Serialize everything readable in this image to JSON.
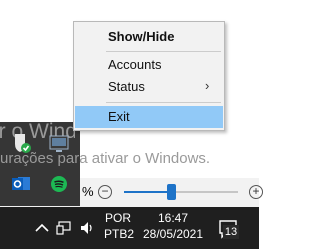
{
  "desktop": {
    "watermark_title": "Ativar o Windows",
    "watermark_hint": "urações para ativar o Windows."
  },
  "tray_flyout": {
    "icons": [
      "shield-check-icon",
      "screen-capture-icon",
      "outlook-icon",
      "spotify-icon"
    ]
  },
  "volume": {
    "percent_suffix": "%",
    "minus_label": "−",
    "plus_label": "+",
    "level": 0.42
  },
  "context_menu": {
    "items": [
      {
        "label": "Show/Hide",
        "bold": true
      },
      {
        "label": "Accounts"
      },
      {
        "label": "Status",
        "submenu_arrow": "›"
      },
      {
        "label": "Exit",
        "highlighted": true
      }
    ]
  },
  "taskbar": {
    "language_line1": "POR",
    "language_line2": "PTB2",
    "time": "16:47",
    "date": "28/05/2021",
    "notification_count": "13"
  },
  "colors": {
    "menu_highlight": "#91c9f7",
    "accent": "#1e73c8",
    "taskbar_bg": "#1f1f1f"
  }
}
